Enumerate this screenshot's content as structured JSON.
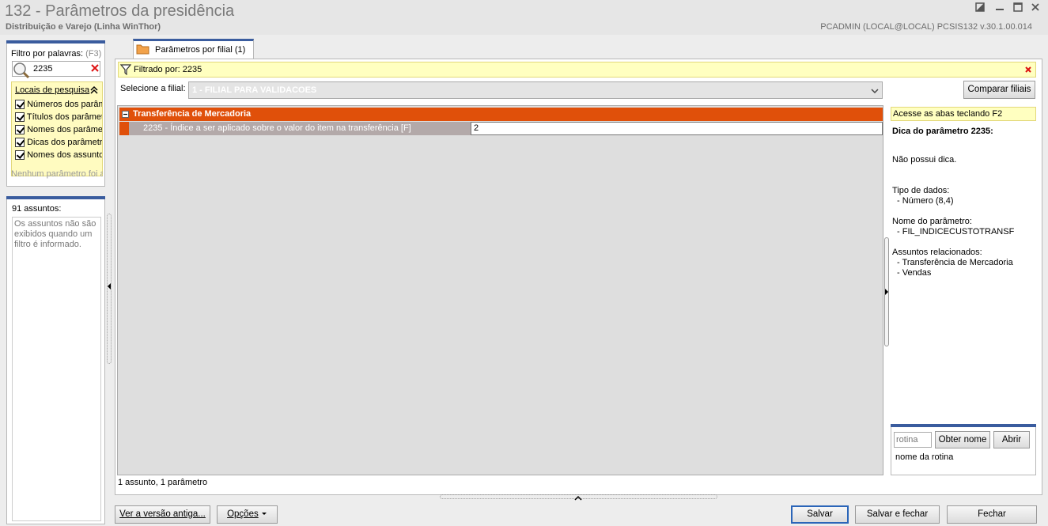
{
  "window": {
    "title": "132 - Parâmetros da presidência",
    "subtitle": "Distribuição e Varejo (Linha WinThor)",
    "user_info": "PCADMIN (LOCAL@LOCAL)   PCSIS132  v.30.1.00.014"
  },
  "filter": {
    "label": "Filtro por palavras:",
    "shortcut": "(F3)",
    "value": "2235",
    "locations_header": "Locais de pesquisa",
    "locations": [
      "Números dos parâmetros",
      "Títulos dos parâmetros",
      "Nomes dos parâmetros",
      "Dicas dos parâmetros",
      "Nomes dos assuntos"
    ],
    "empty_message": "Nenhum parâmetro foi a"
  },
  "subjects": {
    "count_label": "91 assuntos:",
    "info": "Os assuntos não são exibidos quando um filtro é informado."
  },
  "tab": {
    "label": "Parâmetros por filial",
    "count": "(1)"
  },
  "filtered": {
    "label": "Filtrado por: 2235"
  },
  "branch": {
    "label": "Selecione a filial:",
    "value": "1 - FILIAL PARA VALIDACOES",
    "compare_button": "Comparar filiais"
  },
  "grid": {
    "group_title": "Transferência de Mercadoria",
    "rows": [
      {
        "label": "2235 - Índice a ser aplicado sobre o valor do item na transferência [F]",
        "value": "2"
      }
    ],
    "status": "1 assunto, 1 parâmetro"
  },
  "tip": {
    "banner": "Acesse as abas teclando F2",
    "title": "Dica do parâmetro 2235:",
    "text": "Não possui dica.",
    "data_type_label": "Tipo de dados:",
    "data_type_value": "- Número (8,4)",
    "param_name_label": "Nome do parâmetro:",
    "param_name_value": "- FIL_INDICECUSTOTRANSF",
    "related_label": "Assuntos relacionados:",
    "related": [
      "- Transferência de Mercadoria",
      "- Vendas"
    ]
  },
  "routine": {
    "placeholder": "rotina",
    "get_name_button": "Obter nome",
    "open_button": "Abrir",
    "name_label": "nome da rotina"
  },
  "footer": {
    "old_version_button": "Ver a versão antiga...",
    "options_button": "Opções",
    "save_button": "Salvar",
    "save_close_button": "Salvar e fechar",
    "close_button": "Fechar"
  },
  "colors": {
    "group_header": "#e0500a",
    "row_label_bg": "#b3a9a9",
    "blue_accent": "#3a5c9e",
    "filter_bar": "#ffffc0"
  }
}
